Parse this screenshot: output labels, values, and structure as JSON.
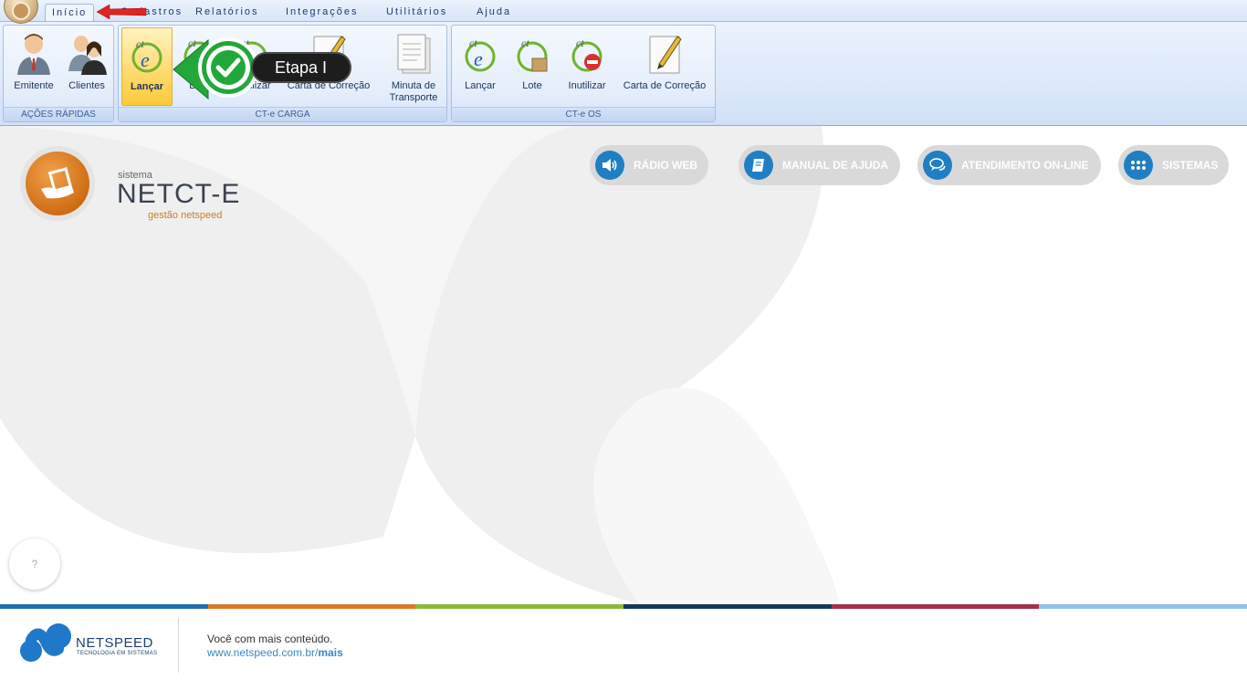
{
  "menu": {
    "tabs": [
      {
        "label": "Início"
      },
      {
        "label": "Cadastros"
      },
      {
        "label": "Relatórios"
      },
      {
        "label": "Integrações"
      },
      {
        "label": "Utilitários"
      },
      {
        "label": "Ajuda"
      }
    ]
  },
  "ribbon": {
    "groups": [
      {
        "label": "AÇÕES RÁPIDAS",
        "buttons": [
          {
            "label": "Emitente",
            "icon": "user-male-icon"
          },
          {
            "label": "Clientes",
            "icon": "users-icon"
          }
        ]
      },
      {
        "label": "CT-e CARGA",
        "buttons": [
          {
            "label": "Lançar",
            "icon": "cte-icon"
          },
          {
            "label": "Lote",
            "icon": "cte-lote-icon"
          },
          {
            "label": "Inutilizar",
            "icon": "cte-inutilizar-icon"
          },
          {
            "label": "Carta de Correção",
            "icon": "pencil-paper-icon"
          },
          {
            "label": "Minuta de",
            "label2": "Transporte",
            "icon": "document-icon"
          }
        ]
      },
      {
        "label": "CT-e OS",
        "buttons": [
          {
            "label": "Lançar",
            "icon": "cte-icon"
          },
          {
            "label": "Lote",
            "icon": "cte-lote-icon"
          },
          {
            "label": "Inutilizar",
            "icon": "cte-inutilizar-icon"
          },
          {
            "label": "Carta de Correção",
            "icon": "pencil-paper-icon"
          }
        ]
      }
    ]
  },
  "callout": {
    "label": "Etapa I"
  },
  "brand": {
    "small": "sistema",
    "name": "NETCT-E",
    "sub": "gestão netspeed"
  },
  "actions": [
    {
      "label": "RÁDIO WEB",
      "icon": "speaker-icon"
    },
    {
      "label": "MANUAL DE AJUDA",
      "icon": "book-icon"
    },
    {
      "label": "ATENDIMENTO ON-LINE",
      "icon": "chat-icon"
    },
    {
      "label": "SISTEMAS",
      "icon": "grid-icon"
    }
  ],
  "help": {
    "label": "?"
  },
  "colors": {
    "stripe": [
      "#1f6fb3",
      "#d9792a",
      "#8bb83c",
      "#123a57",
      "#a3314a",
      "#8fc3ea"
    ],
    "accent_blue": "#1f7fc2",
    "brand_orange": "#d17a1d"
  },
  "footer": {
    "company": "NETSPEED",
    "tagline": "TECNOLOGIA EM SISTEMAS",
    "line1": "Você com mais conteúdo.",
    "url_base": "www.netspeed.com.br/",
    "url_bold": "mais"
  }
}
